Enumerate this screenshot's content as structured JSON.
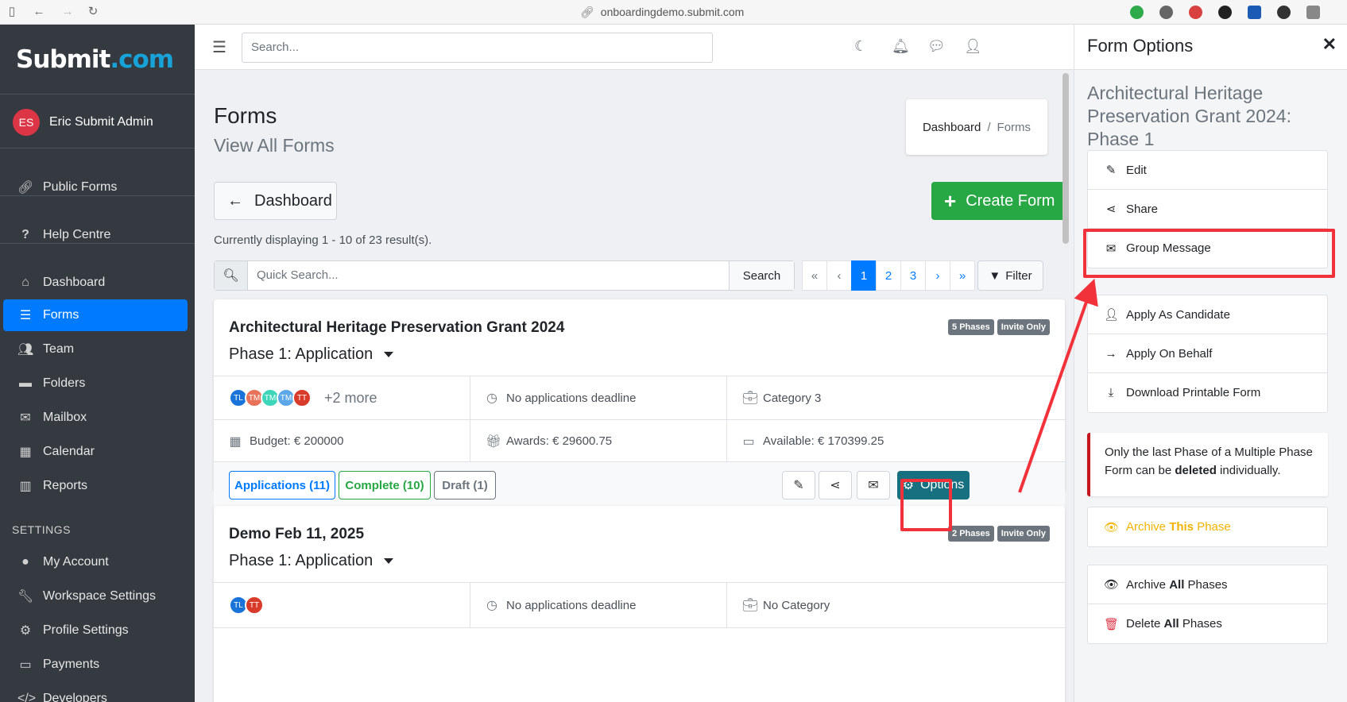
{
  "browser": {
    "url": "onboardingdemo.submit.com"
  },
  "sidebar": {
    "logo_main": "Submit",
    "logo_tld": ".com",
    "user_initials": "ES",
    "user_name": "Eric Submit Admin",
    "links": [
      {
        "label": "Public Forms",
        "icon": "link-icon"
      },
      {
        "label": "Help Centre",
        "icon": "question-icon"
      }
    ],
    "items": [
      {
        "label": "Dashboard",
        "icon": "home-icon"
      },
      {
        "label": "Forms",
        "icon": "list-icon",
        "active": true
      },
      {
        "label": "Team",
        "icon": "users-icon"
      },
      {
        "label": "Folders",
        "icon": "folder-icon"
      },
      {
        "label": "Mailbox",
        "icon": "envelope-icon"
      },
      {
        "label": "Calendar",
        "icon": "calendar-icon"
      },
      {
        "label": "Reports",
        "icon": "chart-icon"
      }
    ],
    "settings_heading": "SETTINGS",
    "settings": [
      {
        "label": "My Account",
        "icon": "account-icon"
      },
      {
        "label": "Workspace Settings",
        "icon": "wrench-icon"
      },
      {
        "label": "Profile Settings",
        "icon": "gear-icon"
      },
      {
        "label": "Payments",
        "icon": "money-icon"
      },
      {
        "label": "Developers",
        "icon": "code-icon"
      }
    ]
  },
  "topbar": {
    "search_placeholder": "Search..."
  },
  "page": {
    "title": "Forms",
    "subtitle": "View All Forms",
    "breadcrumb": [
      "Dashboard",
      "/",
      "Forms"
    ],
    "back_button": "Dashboard",
    "create_button": "Create Form",
    "result_text": "Currently displaying 1 - 10 of 23 result(s).",
    "quick_search_placeholder": "Quick Search...",
    "search_button": "Search",
    "pagination": [
      "«",
      "‹",
      "1",
      "2",
      "3",
      "›",
      "»"
    ],
    "current_page": "1",
    "filter_button": "Filter"
  },
  "cards": [
    {
      "title": "Architectural Heritage Preservation Grant 2024",
      "badges": [
        "5 Phases",
        "Invite Only"
      ],
      "phase": "Phase 1: Application",
      "members": [
        {
          "initials": "TL",
          "color": "#1a73d9"
        },
        {
          "initials": "TM",
          "color": "#e8735a"
        },
        {
          "initials": "TM",
          "color": "#3dd6b9"
        },
        {
          "initials": "TM",
          "color": "#5ba7e8"
        },
        {
          "initials": "TT",
          "color": "#d93b2b"
        }
      ],
      "more_members": "+2 more",
      "deadline": "No applications deadline",
      "category": "Category 3",
      "budget": "Budget: € 200000",
      "awards": "Awards: € 29600.75",
      "available": "Available: € 170399.25",
      "applications_btn": "Applications (11)",
      "complete_btn": "Complete (10)",
      "draft_btn": "Draft (1)",
      "options_btn": "Options"
    },
    {
      "title": "Demo Feb 11, 2025",
      "badges": [
        "2 Phases",
        "Invite Only"
      ],
      "phase": "Phase 1: Application",
      "members": [
        {
          "initials": "TL",
          "color": "#1a73d9"
        },
        {
          "initials": "TT",
          "color": "#d93b2b"
        }
      ],
      "deadline": "No applications deadline",
      "category": "No Category"
    }
  ],
  "panel": {
    "title": "Form Options",
    "form_name": "Architectural Heritage Preservation Grant 2024: Phase 1",
    "group1": [
      {
        "label": "Edit",
        "icon": "pencil-icon"
      },
      {
        "label": "Share",
        "icon": "share-icon"
      },
      {
        "label": "Group Message",
        "icon": "envelope-icon"
      }
    ],
    "group2": [
      {
        "label": "Apply As Candidate",
        "icon": "user-icon"
      },
      {
        "label": "Apply On Behalf",
        "icon": "arrow-right-icon"
      },
      {
        "label": "Download Printable Form",
        "icon": "download-icon"
      }
    ],
    "note_pre": "Only the last Phase of a Multiple Phase Form can be ",
    "note_bold": "deleted",
    "note_post": " individually.",
    "archive_phase_pre": "Archive ",
    "archive_phase_bold": "This",
    "archive_phase_post": " Phase",
    "archive_all_pre": "Archive ",
    "archive_all_bold": "All",
    "archive_all_post": " Phases",
    "delete_all_pre": "Delete ",
    "delete_all_bold": "All",
    "delete_all_post": " Phases"
  },
  "colors": {
    "accent": "#007bff",
    "success": "#28a745",
    "options": "#17707f",
    "annotation": "#f2323b",
    "archive": "#f0b400",
    "danger": "#dc3545"
  }
}
